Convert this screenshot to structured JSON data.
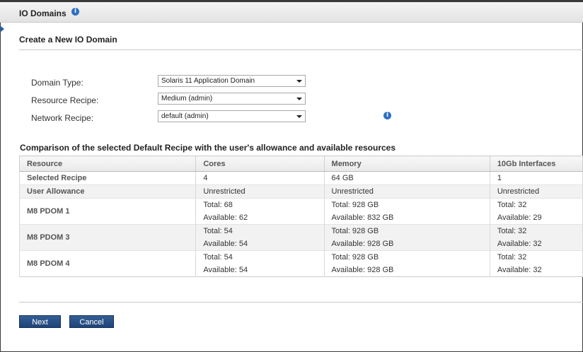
{
  "window": {
    "title": "IO Domains"
  },
  "form": {
    "title": "Create a New IO Domain",
    "fields": [
      {
        "label": "Domain Type:",
        "value": "Solaris 11 Application Domain"
      },
      {
        "label": "Resource Recipe:",
        "value": "Medium (admin)"
      },
      {
        "label": "Network Recipe:",
        "value": "default (admin)"
      }
    ]
  },
  "comparison": {
    "title": "Comparison of the selected Default Recipe with the user's allowance and available resources",
    "headers": [
      "Resource",
      "Cores",
      "Memory",
      "10Gb Interfaces"
    ],
    "rows": [
      {
        "label": "Selected Recipe",
        "cores": [
          "4"
        ],
        "memory": [
          "64 GB"
        ],
        "interfaces": [
          "1"
        ]
      },
      {
        "label": "User Allowance",
        "cores": [
          "Unrestricted"
        ],
        "memory": [
          "Unrestricted"
        ],
        "interfaces": [
          "Unrestricted"
        ]
      },
      {
        "label": "M8 PDOM 1",
        "cores": [
          "Total: 68",
          "Available: 62"
        ],
        "memory": [
          "Total: 928 GB",
          "Available: 832 GB"
        ],
        "interfaces": [
          "Total: 32",
          "Available: 29"
        ]
      },
      {
        "label": "M8 PDOM 3",
        "cores": [
          "Total: 54",
          "Available: 54"
        ],
        "memory": [
          "Total: 928 GB",
          "Available: 928 GB"
        ],
        "interfaces": [
          "Total: 32",
          "Available: 32"
        ]
      },
      {
        "label": "M8 PDOM 4",
        "cores": [
          "Total: 54",
          "Available: 54"
        ],
        "memory": [
          "Total: 928 GB",
          "Available: 928 GB"
        ],
        "interfaces": [
          "Total: 32",
          "Available: 32"
        ]
      }
    ]
  },
  "buttons": {
    "next": "Next",
    "cancel": "Cancel"
  },
  "icons": {
    "info": "info-icon",
    "dropdown": "chevron-down-icon"
  },
  "colors": {
    "accent": "#2c6fc3",
    "button": "#234a80"
  }
}
